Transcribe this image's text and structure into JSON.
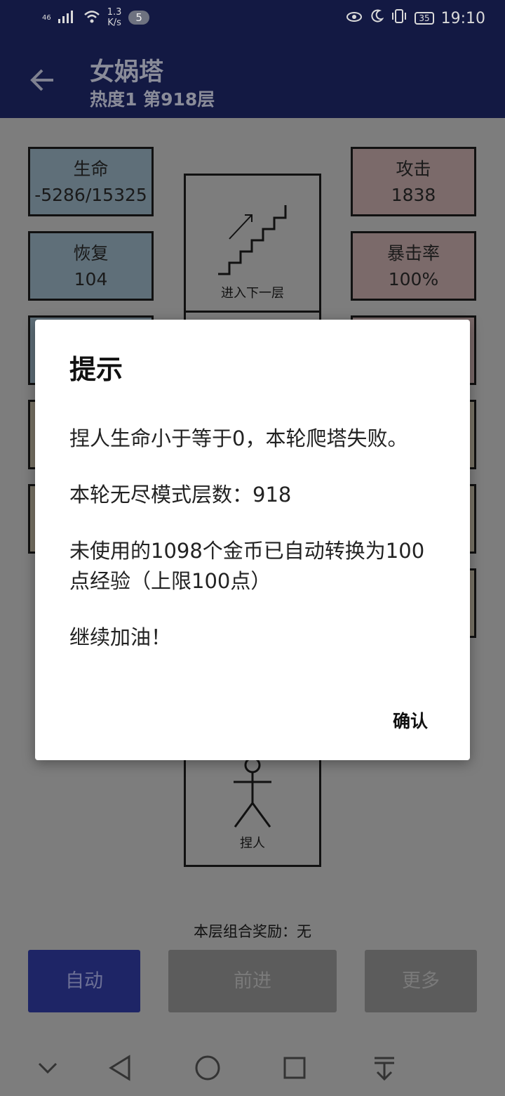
{
  "status_bar": {
    "network_type": "46",
    "speed_value": "1.3",
    "speed_unit": "K/s",
    "notification_count": "5",
    "battery": "35",
    "time": "19:10"
  },
  "app_bar": {
    "title": "女娲塔",
    "subtitle": "热度1 第918层"
  },
  "stats": {
    "life": {
      "label": "生命",
      "value": "-5286/15325"
    },
    "recover": {
      "label": "恢复",
      "value": "104"
    },
    "attack": {
      "label": "攻击",
      "value": "1838"
    },
    "crit_rate": {
      "label": "暴击率",
      "value": "100%"
    }
  },
  "rooms": {
    "next_floor": "进入下一层",
    "player": "捏人"
  },
  "bottom": {
    "combo_reward": "本层组合奖励：无",
    "auto_button": "自动",
    "forward_button": "前进",
    "more_button": "更多"
  },
  "dialog": {
    "title": "提示",
    "line1": "捏人生命小于等于0，本轮爬塔失败。",
    "line2": "本轮无尽模式层数：918",
    "line3": "未使用的1098个金币已自动转换为100点经验（上限100点）",
    "line4": "继续加油！",
    "confirm": "确认"
  },
  "colors": {
    "header": "#131943",
    "accent_button": "#1e2566",
    "dialog_bg": "#ffffff"
  }
}
